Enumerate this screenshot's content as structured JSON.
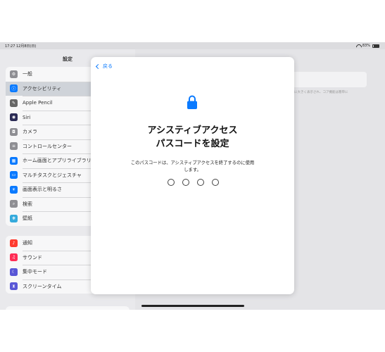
{
  "status_bar": {
    "time": "17:27  12月8日(日)",
    "battery": "83%"
  },
  "sidebar": {
    "title": "設定",
    "groups": [
      [
        {
          "label": "一般",
          "icon": "gear-icon",
          "color": "#8e8e93",
          "selected": false
        },
        {
          "label": "アクセシビリティ",
          "icon": "accessibility-icon",
          "color": "#0a7aff",
          "selected": true
        },
        {
          "label": "Apple Pencil",
          "icon": "pencil-icon",
          "color": "#666666",
          "selected": false
        },
        {
          "label": "Siri",
          "icon": "siri-icon",
          "color": "#2b2b55",
          "selected": false
        },
        {
          "label": "カメラ",
          "icon": "camera-icon",
          "color": "#8e8e93",
          "selected": false
        },
        {
          "label": "コントロールセンター",
          "icon": "control-center-icon",
          "color": "#8e8e93",
          "selected": false
        },
        {
          "label": "ホーム画面とアプリライブラリ",
          "icon": "home-screen-icon",
          "color": "#0a7aff",
          "selected": false
        },
        {
          "label": "マルチタスクとジェスチャ",
          "icon": "multitasking-icon",
          "color": "#0a7aff",
          "selected": false
        },
        {
          "label": "画面表示と明るさ",
          "icon": "brightness-icon",
          "color": "#0a7aff",
          "selected": false
        },
        {
          "label": "検索",
          "icon": "search-icon",
          "color": "#8e8e93",
          "selected": false
        },
        {
          "label": "壁紙",
          "icon": "wallpaper-icon",
          "color": "#35aadc",
          "selected": false
        }
      ],
      [
        {
          "label": "通知",
          "icon": "bell-icon",
          "color": "#ff3b30",
          "selected": false
        },
        {
          "label": "サウンド",
          "icon": "speaker-icon",
          "color": "#ff2d55",
          "selected": false
        },
        {
          "label": "集中モード",
          "icon": "moon-icon",
          "color": "#5856d6",
          "selected": false
        },
        {
          "label": "スクリーンタイム",
          "icon": "hourglass-icon",
          "color": "#5856d6",
          "selected": false
        }
      ]
    ]
  },
  "modal": {
    "back_label": "戻る",
    "heading_line1": "アシスティブアクセス",
    "heading_line2": "パスコードを設定",
    "description": "このパスコードは、アシスティブアクセスを終了するのに使用します。",
    "passcode_length": 4
  },
  "detail": {
    "note": "に大きく表示され、コア機能は簡単に"
  },
  "colors": {
    "accent": "#0a7aff"
  }
}
